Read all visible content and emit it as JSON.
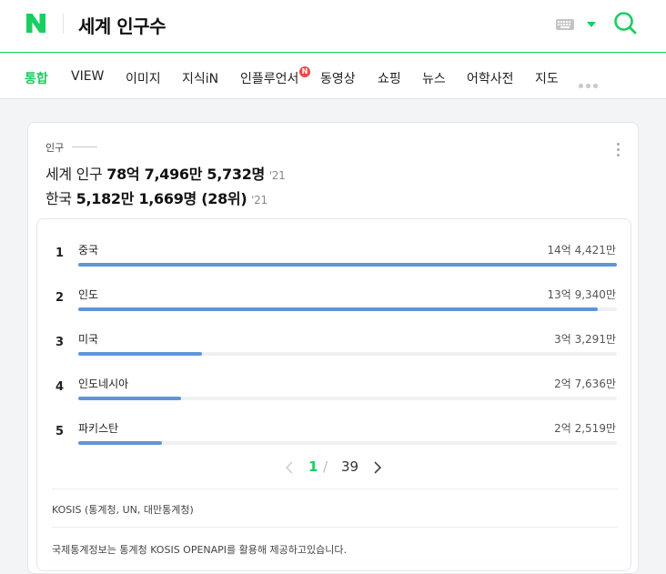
{
  "header": {
    "logo_letter": "N",
    "query": "세계 인구수",
    "brand_color": "#19ce60"
  },
  "tabs": [
    {
      "label": "통합",
      "active": true
    },
    {
      "label": "VIEW"
    },
    {
      "label": "이미지"
    },
    {
      "label": "지식iN"
    },
    {
      "label": "인플루언서",
      "badge": "N"
    },
    {
      "label": "동영상"
    },
    {
      "label": "쇼핑"
    },
    {
      "label": "뉴스"
    },
    {
      "label": "어학사전"
    },
    {
      "label": "지도"
    }
  ],
  "card": {
    "section_label": "인구",
    "world": {
      "label": "세계 인구",
      "value": "78억 7,496만 5,732명",
      "year": "'21"
    },
    "korea": {
      "label": "한국",
      "value": "5,182만 1,669명 (28위)",
      "year": "'21"
    },
    "ranking": [
      {
        "rank": "1",
        "country": "중국",
        "amount": "14억 4,421만",
        "share": 1.0
      },
      {
        "rank": "2",
        "country": "인도",
        "amount": "13억 9,340만",
        "share": 0.965
      },
      {
        "rank": "3",
        "country": "미국",
        "amount": "3억 3,291만",
        "share": 0.23
      },
      {
        "rank": "4",
        "country": "인도네시아",
        "amount": "2억 7,636만",
        "share": 0.191
      },
      {
        "rank": "5",
        "country": "파키스탄",
        "amount": "2억 2,519만",
        "share": 0.156
      }
    ],
    "pagination": {
      "current": "1",
      "separator": "/",
      "total": "39"
    },
    "source": "KOSIS (통계청, UN, 대만통계청)",
    "note": "국제통계정보는 통계청 KOSIS OPENAPI를 활용해 제공하고있습니다."
  }
}
